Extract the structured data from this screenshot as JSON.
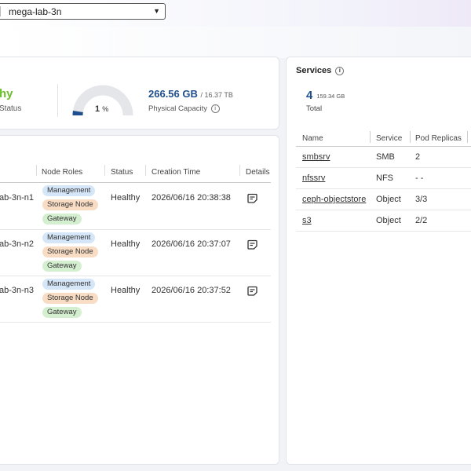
{
  "header": {
    "cluster_name": "mega-lab-3n"
  },
  "summary": {
    "status_value": "hy",
    "status_label": "Status",
    "usage_percent": 1,
    "usage_symbol": "%",
    "capacity_used": "266.56 GB",
    "capacity_total": "/ 16.37 TB",
    "capacity_label": "Physical Capacity"
  },
  "nodes": {
    "columns": [
      "Node Roles",
      "Status",
      "Creation Time",
      "Details"
    ],
    "rows": [
      {
        "name": "ab-3n-n1",
        "roles": [
          "Management",
          "Storage Node",
          "Gateway"
        ],
        "status": "Healthy",
        "created": "2026/06/16 20:38:38"
      },
      {
        "name": "ab-3n-n2",
        "roles": [
          "Management",
          "Storage Node",
          "Gateway"
        ],
        "status": "Healthy",
        "created": "2026/06/16 20:37:07"
      },
      {
        "name": "ab-3n-n3",
        "roles": [
          "Management",
          "Storage Node",
          "Gateway"
        ],
        "status": "Healthy",
        "created": "2026/06/16 20:37:52"
      }
    ]
  },
  "services": {
    "title": "Services",
    "count": "4",
    "size": "159.34 GB",
    "total_label": "Total",
    "columns": [
      "Name",
      "Service",
      "Pod Replicas"
    ],
    "rows": [
      {
        "name": "smbsrv",
        "service": "SMB",
        "replicas": "2"
      },
      {
        "name": "nfssrv",
        "service": "NFS",
        "replicas": "- -"
      },
      {
        "name": "ceph-objectstore",
        "service": "Object",
        "replicas": "3/3"
      },
      {
        "name": "s3",
        "service": "Object",
        "replicas": "2/2"
      }
    ]
  },
  "colors": {
    "healthy": "#6cbf2c",
    "accent": "#1f4f8e",
    "gauge_track": "#e4e6ea",
    "gauge_fill": "#1f4f8e"
  },
  "icons": {
    "details": "note-icon",
    "info": "info-icon",
    "dropdown": "caret-down-icon"
  }
}
